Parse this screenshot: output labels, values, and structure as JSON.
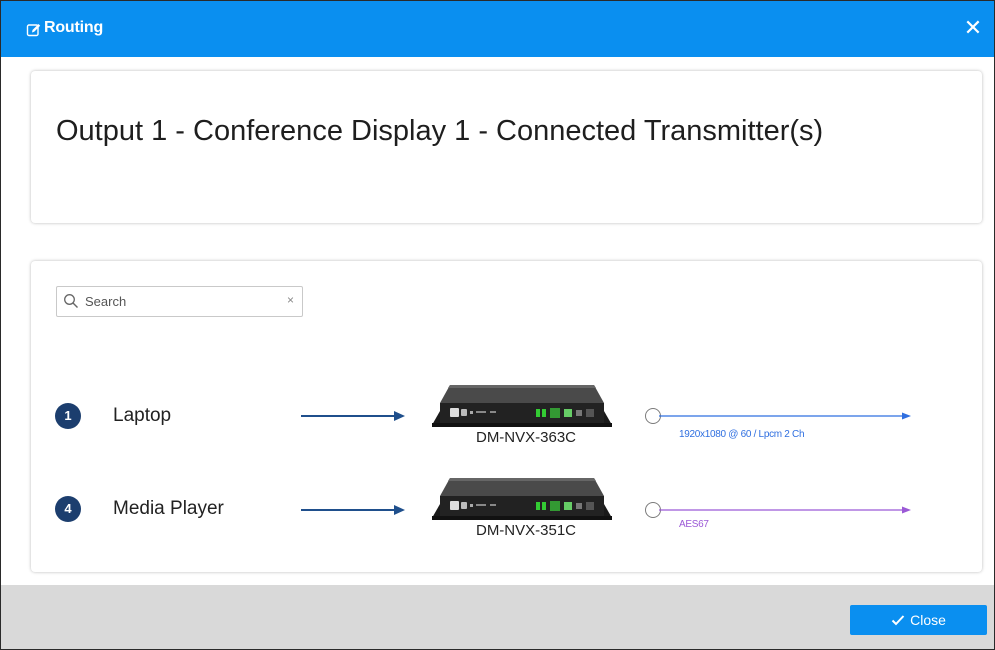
{
  "dialog": {
    "title": "Routing",
    "close_symbol": "✕",
    "heading": "Output 1 - Conference Display 1 - Connected Transmitter(s)"
  },
  "search": {
    "placeholder": "Search",
    "value": "",
    "clear_symbol": "×"
  },
  "sources": [
    {
      "number": "1",
      "name": "Laptop",
      "device": "DM-NVX-363C",
      "signal": "1920x1080 @ 60 / Lpcm 2 Ch",
      "signal_color": "#2f6fe0"
    },
    {
      "number": "4",
      "name": "Media Player",
      "device": "DM-NVX-351C",
      "signal": "AES67",
      "signal_color": "#9b59d6"
    }
  ],
  "footer": {
    "close_label": "Close"
  },
  "colors": {
    "titlebar": "#0a8ff0",
    "badge": "#1c3e6e",
    "input_arrow": "#1f4f8c",
    "footer": "#d9d9d9"
  },
  "icons": {
    "title": "edit-icon",
    "search": "search-icon",
    "close_button": "checkmark-icon"
  }
}
